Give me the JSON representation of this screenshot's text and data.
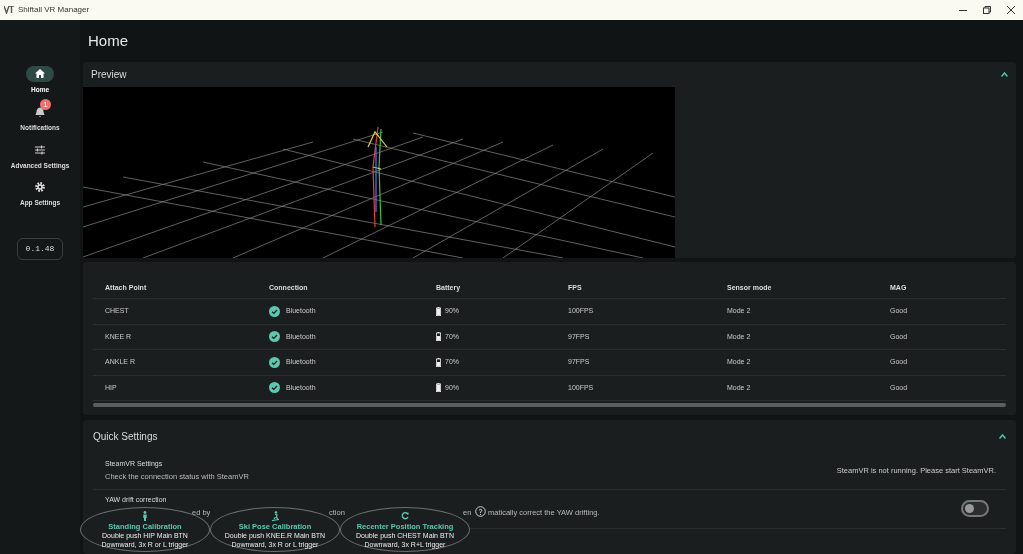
{
  "window": {
    "title": "Shiftall VR Manager"
  },
  "sidebar": {
    "items": [
      {
        "label": "Home",
        "selected": true
      },
      {
        "label": "Notifications",
        "selected": false,
        "badge": "1"
      },
      {
        "label": "Advanced Settings",
        "selected": false
      },
      {
        "label": "App Settings",
        "selected": false
      }
    ],
    "version": "0.1.48"
  },
  "page_title": "Home",
  "preview": {
    "title": "Preview",
    "expanded": true
  },
  "table": {
    "columns": [
      "Attach Point",
      "Connection",
      "Battery",
      "FPS",
      "Sensor mode",
      "MAG"
    ],
    "rows": [
      {
        "attach_point": "CHEST",
        "connection": "Bluetooth",
        "connected": true,
        "battery": "90%",
        "kind": "full",
        "fps": "100FPS",
        "sensor_mode": "Mode 2",
        "mag": "Good"
      },
      {
        "attach_point": "KNEE R",
        "connection": "Bluetooth",
        "connected": true,
        "battery": "70%",
        "kind": "partial",
        "fps": "97FPS",
        "sensor_mode": "Mode 2",
        "mag": "Good"
      },
      {
        "attach_point": "ANKLE R",
        "connection": "Bluetooth",
        "connected": true,
        "battery": "70%",
        "kind": "partial",
        "fps": "97FPS",
        "sensor_mode": "Mode 2",
        "mag": "Good"
      },
      {
        "attach_point": "HIP",
        "connection": "Bluetooth",
        "connected": true,
        "battery": "90%",
        "kind": "full",
        "fps": "100FPS",
        "sensor_mode": "Mode 2",
        "mag": "Good"
      }
    ]
  },
  "quick_settings": {
    "title": "Quick Settings",
    "expanded": true,
    "steamvr": {
      "title": "SteamVR Settings",
      "description": "Check the connection status with SteamVR",
      "status": "SteamVR is not running. Please start SteamVR."
    },
    "yaw": {
      "title": "YAW drift correction",
      "description_fragments": [
        "ed by",
        "ction",
        "en",
        "matically correct the YAW drifting."
      ],
      "on": false
    }
  },
  "calibration_buttons": [
    {
      "title": "Standing Calibration",
      "line_1": "Double push HIP Main BTN",
      "line_2": "Downward, 3x R or L trigger"
    },
    {
      "title": "Ski Pose Calibration",
      "line_1": "Double push KNEE.R Main BTN",
      "line_2": "Downward, 3x R or L trigger"
    },
    {
      "title": "Recenter Position Tracking",
      "line_1": "Double push CHEST Main BTN",
      "line_2": "Downward, 3x R+L trigger"
    }
  ]
}
